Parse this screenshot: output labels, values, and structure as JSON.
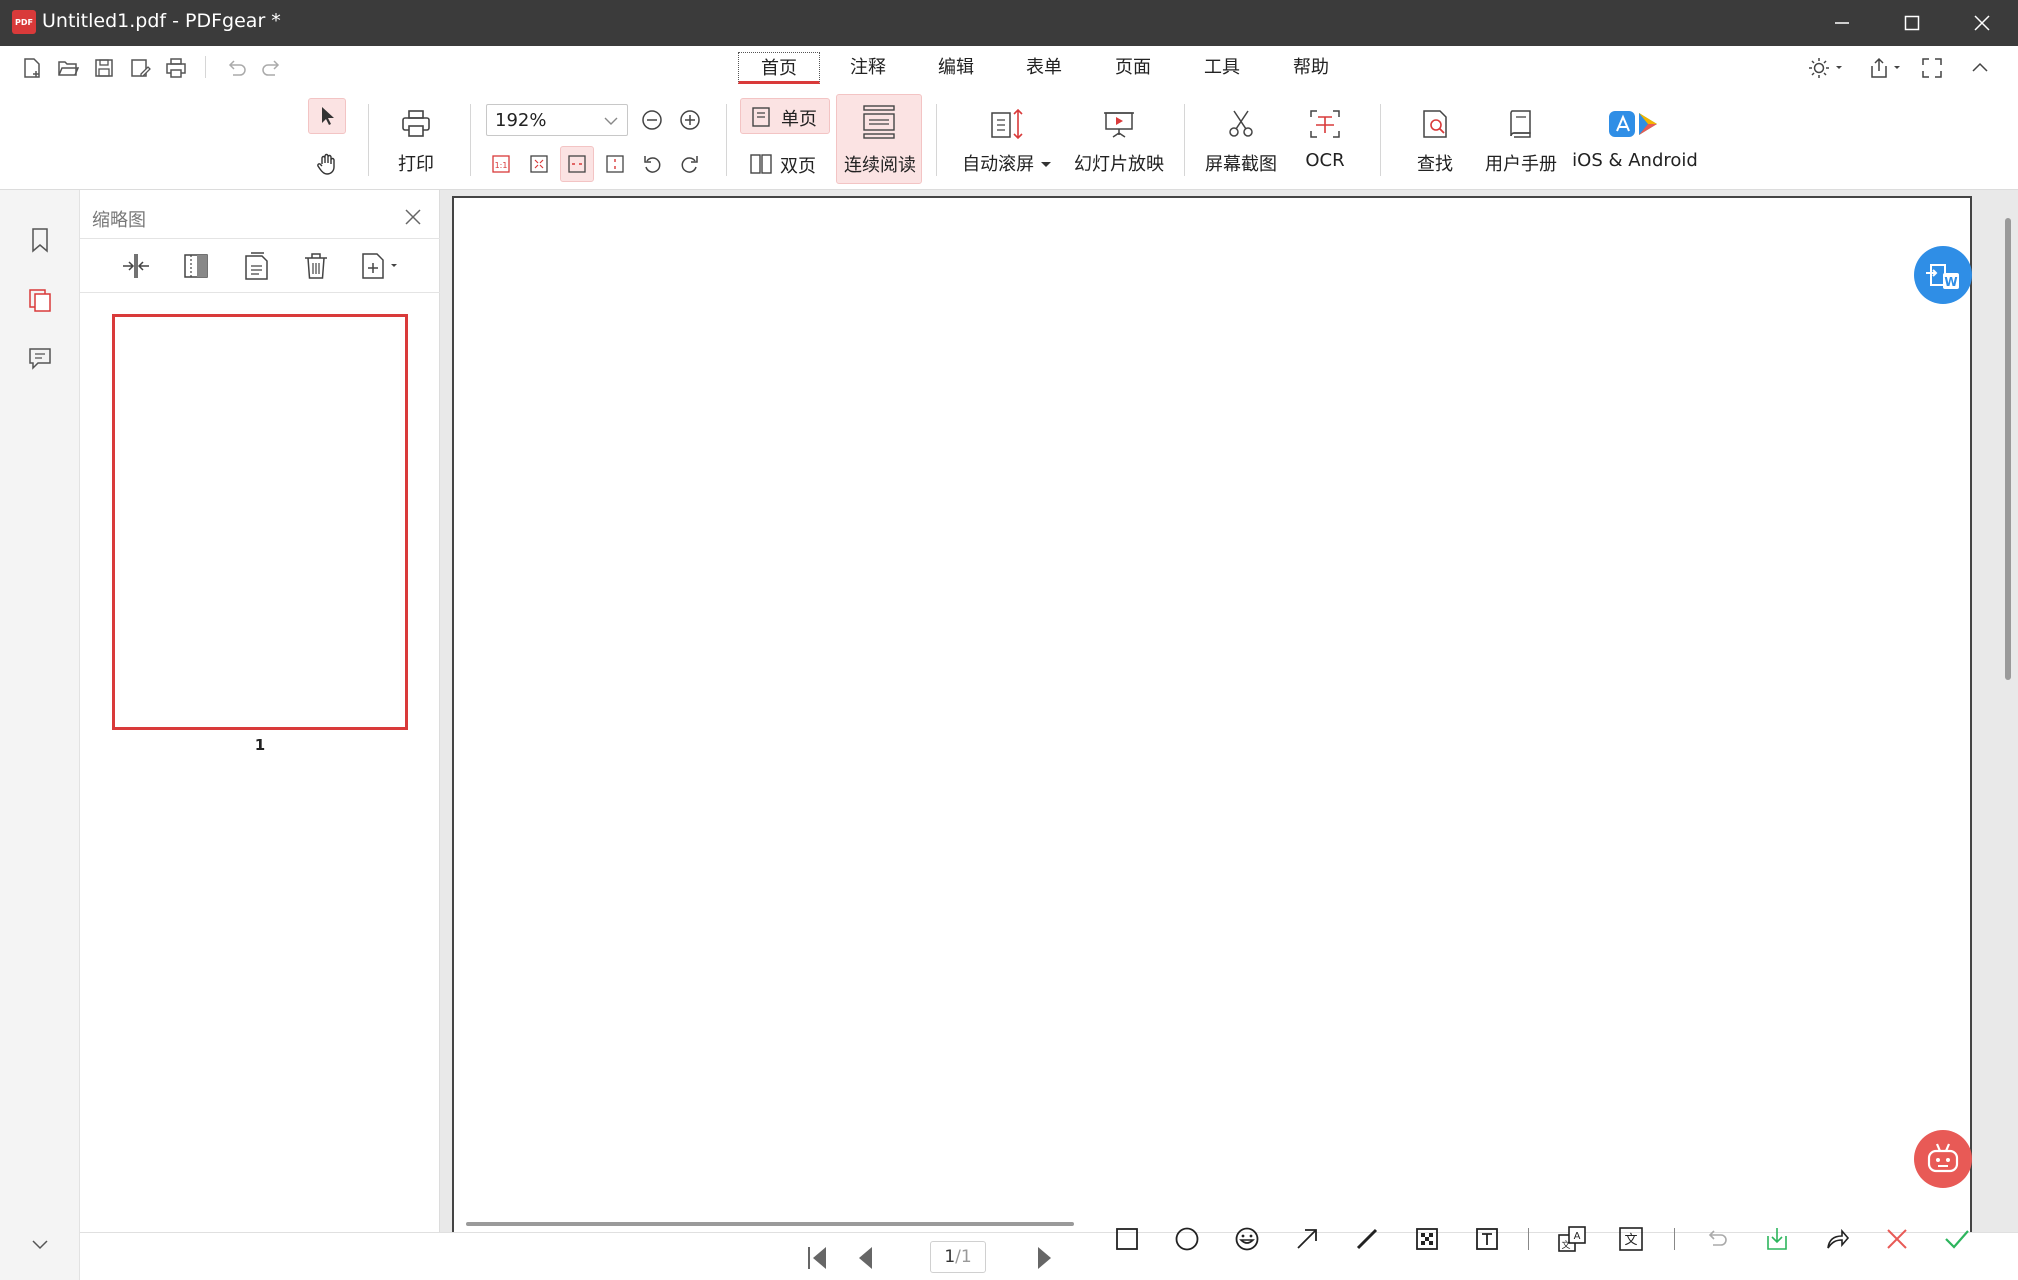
{
  "window": {
    "title": "Untitled1.pdf - PDFgear *",
    "app_icon_text": "PDF"
  },
  "menu": {
    "tabs": [
      "首页",
      "注释",
      "编辑",
      "表单",
      "页面",
      "工具",
      "帮助"
    ],
    "active_tab": "首页"
  },
  "ribbon": {
    "print_label": "打印",
    "zoom_value": "192%",
    "single_page_label": "单页",
    "double_page_label": "双页",
    "continuous_label": "连续阅读",
    "auto_scroll_label": "自动滚屏",
    "slideshow_label": "幻灯片放映",
    "screenshot_label": "屏幕截图",
    "ocr_label": "OCR",
    "find_label": "查找",
    "manual_label": "用户手册",
    "mobile_label": "iOS & Android"
  },
  "thumbnail_panel": {
    "title": "缩略图",
    "page_number": "1"
  },
  "status": {
    "page_indicator_current": "1",
    "page_indicator_total": "/1"
  },
  "colors": {
    "accent": "#d93a3a",
    "titlebar": "#3b3b3b",
    "floating_blue": "#2f8ee6",
    "floating_red": "#e85a56",
    "ok_green": "#2db55d"
  }
}
